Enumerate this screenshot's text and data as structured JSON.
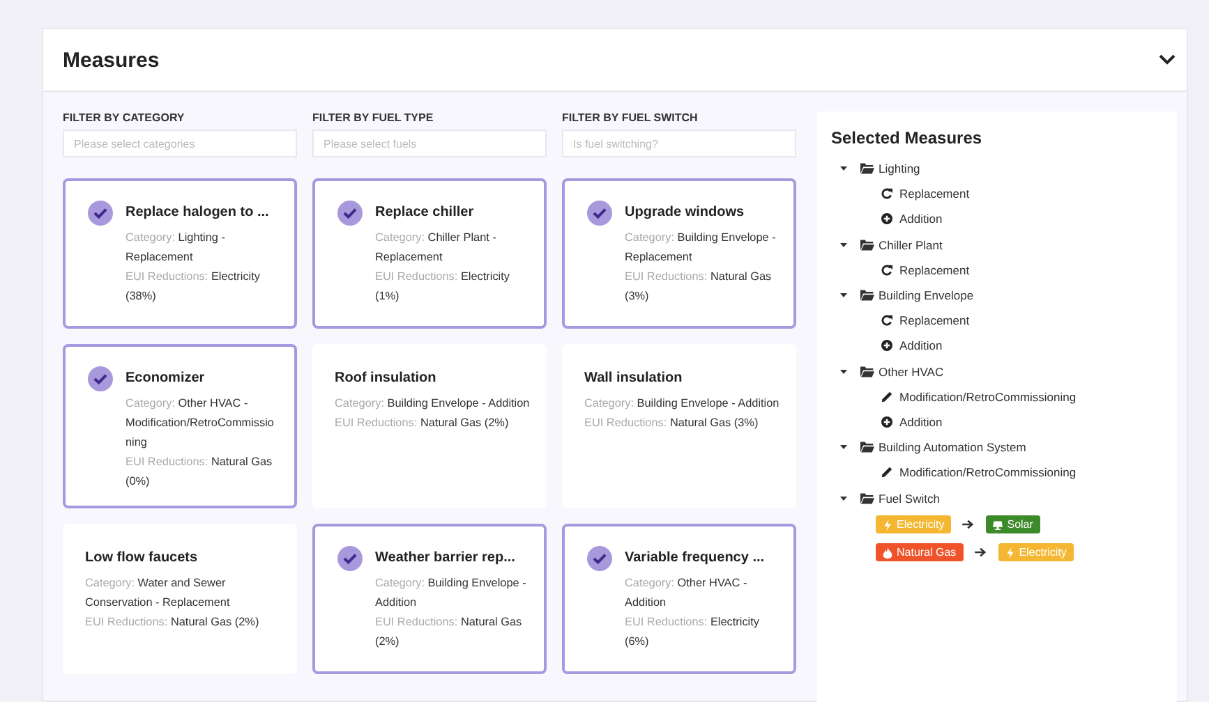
{
  "panel": {
    "title": "Measures",
    "expanded": true
  },
  "filters": [
    {
      "label": "FILTER BY CATEGORY",
      "placeholder": "Please select categories"
    },
    {
      "label": "FILTER BY FUEL TYPE",
      "placeholder": "Please select fuels"
    },
    {
      "label": "FILTER BY FUEL SWITCH",
      "placeholder": "Is fuel switching?"
    }
  ],
  "measures": [
    {
      "title": "Replace halogen to ...",
      "selected": true,
      "fields": [
        {
          "label": "Category:",
          "value": "Lighting - Replacement"
        },
        {
          "label": "EUI Reductions:",
          "value": "Electricity (38%)"
        }
      ]
    },
    {
      "title": "Replace chiller",
      "selected": true,
      "fields": [
        {
          "label": "Category:",
          "value": "Chiller Plant - Replacement"
        },
        {
          "label": "EUI Reductions:",
          "value": "Electricity (1%)"
        }
      ]
    },
    {
      "title": "Upgrade windows",
      "selected": true,
      "fields": [
        {
          "label": "Category:",
          "value": "Building Envelope - Replacement"
        },
        {
          "label": "EUI Reductions:",
          "value": "Natural Gas (3%)"
        }
      ]
    },
    {
      "title": "Economizer",
      "selected": true,
      "fields": [
        {
          "label": "Category:",
          "value": "Other HVAC - Modification/RetroCommissioning"
        },
        {
          "label": "EUI Reductions:",
          "value": "Natural Gas (0%)"
        }
      ]
    },
    {
      "title": "Roof insulation",
      "selected": false,
      "fields": [
        {
          "label": "Category:",
          "value": "Building Envelope - Addition"
        },
        {
          "label": "EUI Reductions:",
          "value": "Natural Gas (2%)"
        }
      ]
    },
    {
      "title": "Wall insulation",
      "selected": false,
      "fields": [
        {
          "label": "Category:",
          "value": "Building Envelope - Addition"
        },
        {
          "label": "EUI Reductions:",
          "value": "Natural Gas (3%)"
        }
      ]
    },
    {
      "title": "Low flow faucets",
      "selected": false,
      "fields": [
        {
          "label": "Category:",
          "value": "Water and Sewer Conservation - Replacement"
        },
        {
          "label": "EUI Reductions:",
          "value": "Natural Gas (2%)"
        }
      ]
    },
    {
      "title": "Weather barrier rep...",
      "selected": true,
      "fields": [
        {
          "label": "Category:",
          "value": "Building Envelope - Addition"
        },
        {
          "label": "EUI Reductions:",
          "value": "Natural Gas (2%)"
        }
      ]
    },
    {
      "title": "Variable frequency ...",
      "selected": true,
      "fields": [
        {
          "label": "Category:",
          "value": "Other HVAC - Addition"
        },
        {
          "label": "EUI Reductions:",
          "value": "Electricity (6%)"
        }
      ]
    }
  ],
  "selected_measures": {
    "title": "Selected Measures",
    "tree": [
      {
        "label": "Lighting",
        "expanded": true,
        "children": [
          {
            "label": "Replacement",
            "kind": "replacement"
          },
          {
            "label": "Addition",
            "kind": "addition"
          }
        ]
      },
      {
        "label": "Chiller Plant",
        "expanded": true,
        "children": [
          {
            "label": "Replacement",
            "kind": "replacement"
          }
        ]
      },
      {
        "label": "Building Envelope",
        "expanded": true,
        "children": [
          {
            "label": "Replacement",
            "kind": "replacement"
          },
          {
            "label": "Addition",
            "kind": "addition"
          }
        ]
      },
      {
        "label": "Other HVAC",
        "expanded": true,
        "children": [
          {
            "label": "Modification/RetroCommissioning",
            "kind": "modification"
          },
          {
            "label": "Addition",
            "kind": "addition"
          }
        ]
      },
      {
        "label": "Building Automation System",
        "expanded": true,
        "children": [
          {
            "label": "Modification/RetroCommissioning",
            "kind": "modification"
          }
        ]
      },
      {
        "label": "Fuel Switch",
        "expanded": true,
        "switches": [
          {
            "from": {
              "label": "Electricity",
              "kind": "electricity",
              "color": "#f5b731"
            },
            "to": {
              "label": "Solar",
              "kind": "solar",
              "color": "#3d8a2a"
            }
          },
          {
            "from": {
              "label": "Natural Gas",
              "kind": "gas",
              "color": "#f0532a"
            },
            "to": {
              "label": "Electricity",
              "kind": "electricity",
              "color": "#f5b731"
            }
          }
        ]
      }
    ]
  }
}
